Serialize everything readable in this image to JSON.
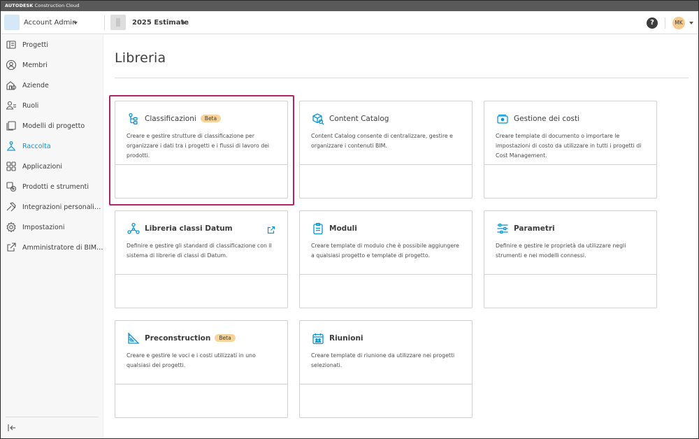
{
  "brand": {
    "bold": "AUTODESK",
    "rest": " Construction Cloud"
  },
  "header": {
    "account_name": "Account Admin",
    "project_name": "2025 Estimate",
    "help_label": "?",
    "avatar_initials": "MK"
  },
  "sidebar": {
    "items": [
      {
        "label": "Progetti",
        "icon": "projects-icon",
        "active": false
      },
      {
        "label": "Membri",
        "icon": "members-icon",
        "active": false
      },
      {
        "label": "Aziende",
        "icon": "companies-icon",
        "active": false
      },
      {
        "label": "Ruoli",
        "icon": "roles-icon",
        "active": false
      },
      {
        "label": "Modelli di progetto",
        "icon": "project-templates-icon",
        "active": false
      },
      {
        "label": "Raccolta",
        "icon": "library-icon",
        "active": true
      },
      {
        "label": "Applicazioni",
        "icon": "apps-icon",
        "active": false
      },
      {
        "label": "Prodotti e strumenti",
        "icon": "products-tools-icon",
        "active": false
      },
      {
        "label": "Integrazioni personali…",
        "icon": "integrations-icon",
        "active": false
      },
      {
        "label": "Impostazioni",
        "icon": "settings-icon",
        "active": false
      },
      {
        "label": "Amministratore di BIM…",
        "icon": "external-link-icon",
        "active": false
      }
    ],
    "collapse_icon": "collapse-sidebar-icon"
  },
  "main": {
    "title": "Libreria",
    "cards": [
      {
        "title": "Classificazioni",
        "badge": "Beta",
        "icon": "classification-tree-icon",
        "desc": "Creare e gestire strutture di classificazione per organizzare i dati tra i progetti e i flussi di lavoro dei prodotti."
      },
      {
        "title": "Content Catalog",
        "badge": "",
        "icon": "content-catalog-icon",
        "desc": "Content Catalog consente di centralizzare, gestire e organizzare i contenuti BIM."
      },
      {
        "title": "Gestione dei costi",
        "badge": "",
        "icon": "cost-management-icon",
        "desc": "Creare template di documento o importare le impostazioni di costo da utilizzare in tutti i progetti di Cost Management."
      },
      {
        "title": "Libreria classi Datum",
        "badge": "",
        "icon": "datum-network-icon",
        "desc": "Definire e gestire gli standard di classificazione con il sistema di librerie di classi di Datum."
      },
      {
        "title": "Moduli",
        "badge": "",
        "icon": "forms-clipboard-icon",
        "desc": "Creare template di modulo che è possibile aggiungere a qualsiasi progetto e template di progetto."
      },
      {
        "title": "Parametri",
        "badge": "",
        "icon": "parameters-sliders-icon",
        "desc": "Definire e gestire le proprietà da utilizzare negli strumenti e nei modelli connessi."
      },
      {
        "title": "Preconstruction",
        "badge": "Beta",
        "icon": "preconstruction-icon",
        "desc": "Creare e gestire le voci e i costi utilizzati in uno qualsiasi dei progetti."
      },
      {
        "title": "Riunioni",
        "badge": "",
        "icon": "meetings-calendar-icon",
        "desc": "Creare template di riunione da utilizzare nei progetti selezionati."
      }
    ]
  },
  "colors": {
    "accent": "#0696d7",
    "highlight": "#b0246e",
    "badge": "#f6d39a"
  }
}
